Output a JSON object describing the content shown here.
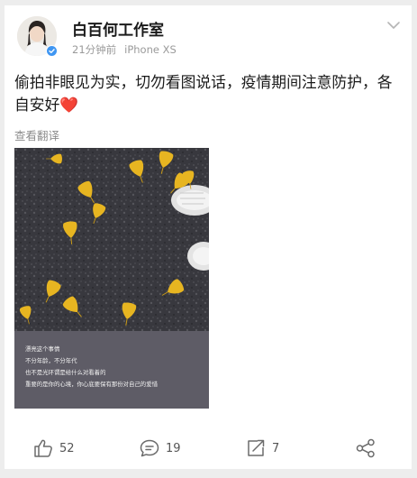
{
  "post": {
    "author": "白百何工作室",
    "time": "21分钟前",
    "device": "iPhone XS",
    "text": "偷拍非眼见为实，切勿看图说话，疫情期间注意防护，各自安好",
    "emoji": "❤️",
    "translate_label": "查看翻译",
    "verified_icon": "verified-badge-icon",
    "menu_icon": "chevron-down-icon"
  },
  "image": {
    "description_icon": "ginkgo-leaves-on-asphalt-photo",
    "caption_lines": [
      "漂亮这个事情",
      "不分年龄，不分年代",
      "也不是光环谓是给什么对看着的",
      "重要的是你的心境，你心底要保有那份对自己的爱惜"
    ]
  },
  "actions": {
    "like": {
      "icon": "thumbs-up-icon",
      "count": "52"
    },
    "comment": {
      "icon": "comment-icon",
      "count": "19"
    },
    "repost": {
      "icon": "repost-icon",
      "count": "7"
    },
    "share": {
      "icon": "share-icon"
    }
  },
  "colors": {
    "background": "#ededed",
    "card": "#ffffff",
    "verified": "#3f96f2",
    "heart": "#e0192b",
    "leaf": "#e7b521"
  }
}
